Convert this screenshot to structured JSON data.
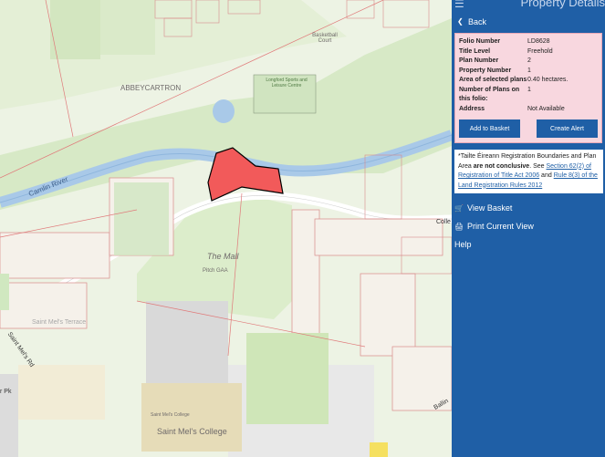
{
  "header": {
    "title": "Property Details",
    "menu_icon": "hamburger-icon"
  },
  "nav": {
    "back_label": "Back"
  },
  "property": {
    "rows": [
      {
        "key": "Folio Number",
        "value": "LD8628"
      },
      {
        "key": "Title Level",
        "value": "Freehold"
      },
      {
        "key": "Plan Number",
        "value": "2"
      },
      {
        "key": "Property Number",
        "value": "1"
      },
      {
        "key": "Area of selected plans",
        "value": "0.40 hectares."
      },
      {
        "key": "Number of Plans on this folio:",
        "value": "1"
      },
      {
        "key": "Address",
        "value": "Not Available"
      }
    ],
    "add_basket_label": "Add to Basket",
    "create_alert_label": "Create Alert"
  },
  "notice": {
    "prefix": "*Tailte Éireann Registration Boundaries and Plan Area ",
    "bold": "are not conclusive",
    "see": ". See ",
    "link1": "Section 62(2) of Registration of Title Act 2006",
    "and": " and ",
    "link2": "Rule 8(3) of the Land Registration Rules 2012"
  },
  "menu": {
    "view_basket": "View Basket",
    "print_view": "Print Current View",
    "help": "Help"
  },
  "map": {
    "labels": {
      "abbeycartron": "ABBEYCARTRON",
      "camlin": "Camlin River",
      "mall": "The Mall",
      "pitch": "Pitch GAA",
      "basketball": "Basketball Court",
      "sports": "Longford Sports and Leisure Centre",
      "mels_rd": "Saint Mel's Rd",
      "college": "Saint Mel's College",
      "college_small": "Saint Mel's College",
      "coll_road": "Colle",
      "ballin": "Ballin",
      "pk": "r Pk",
      "mel_terrace": "Saint Mel's Terrace"
    }
  },
  "colors": {
    "panel": "#1f5fa6",
    "highlight": "#f25a5a",
    "info_bg": "#f8d7df"
  }
}
